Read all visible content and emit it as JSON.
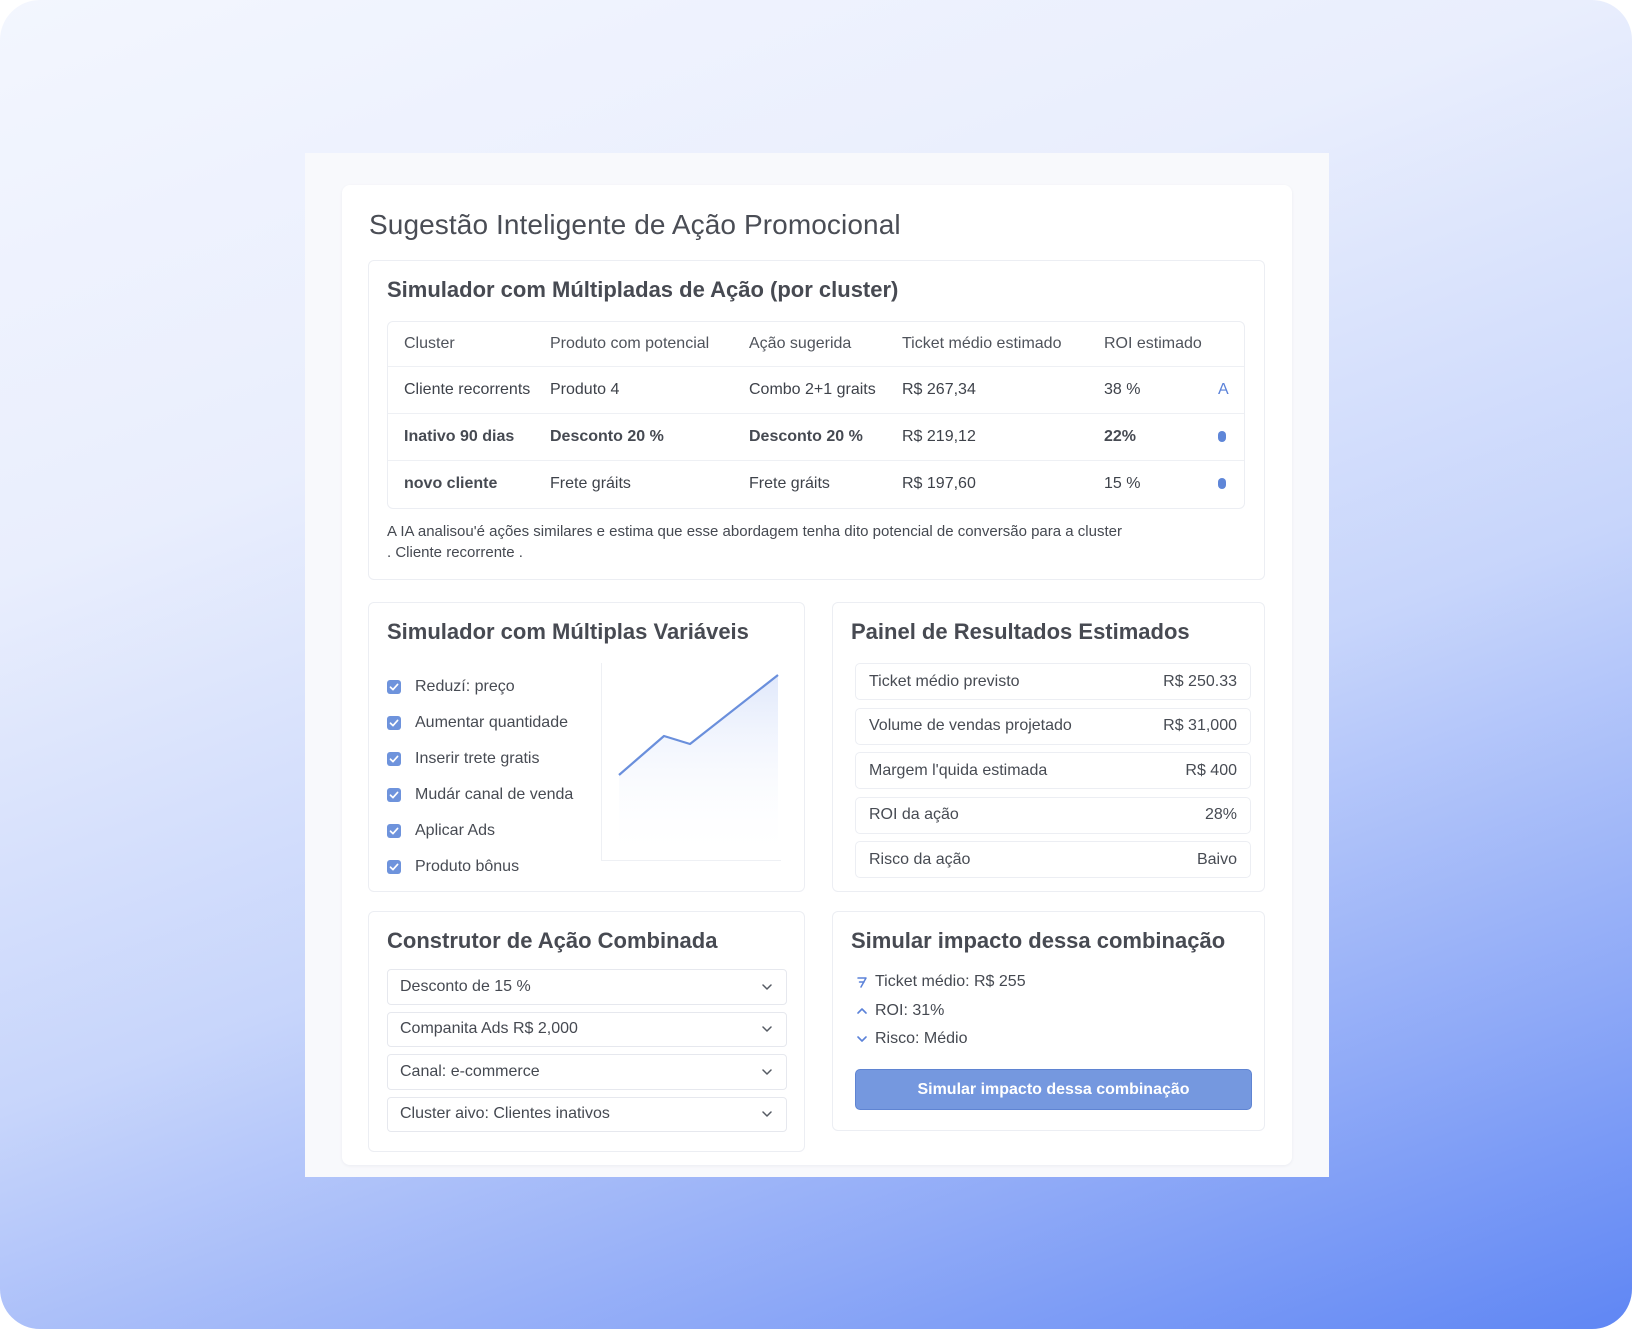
{
  "page_title": "Sugestão Inteligente de Ação Promocional",
  "cluster_sim": {
    "title": "Simulador com Múltipladas de Ação (por cluster)",
    "columns": [
      "Cluster",
      "Produto com potencial",
      "Ação sugerida",
      "Ticket médio estimado",
      "ROI estimado"
    ],
    "rows": [
      {
        "cluster": "Cliente recorrents",
        "produto": "Produto 4",
        "acao": "Combo 2+1 graits",
        "ticket": "R$ 267,34",
        "roi": "38 %",
        "tag": "A"
      },
      {
        "cluster": "Inativo 90 dias",
        "produto": "Desconto 20 %",
        "acao": "Desconto 20 %",
        "ticket": "R$ 219,12",
        "roi": "22%",
        "tag": ""
      },
      {
        "cluster": "novo cliente",
        "produto": "Frete gráits",
        "acao": "Frete gráits",
        "ticket": "R$ 197,60",
        "roi": "15 %",
        "tag": ""
      }
    ],
    "note_line1": "A IA analisou'é ações similares e estima que esse abordagem tenha dito potencial de conversão para a cluster",
    "note_line2": ". Cliente recorrente ."
  },
  "variables": {
    "title": "Simulador com Múltiplas Variáveis",
    "items": [
      "Reduzí: preço",
      "Aumentar quantidade",
      "Inserir trete gratis",
      "Mudár canal de venda",
      "Aplicar Ads",
      "Produto bônus"
    ],
    "accent": "#5b82d9"
  },
  "results": {
    "title": "Painel de Resultados Estimados",
    "rows": [
      {
        "label": "Ticket médio previsto",
        "value": "R$ 250.33"
      },
      {
        "label": "Volume de vendas projetado",
        "value": "R$ 31,000"
      },
      {
        "label": "Margem l'quida estimada",
        "value": "R$ 400"
      },
      {
        "label": "ROI da ação",
        "value": "28%"
      },
      {
        "label": "Risco da ação",
        "value": "Baivo"
      }
    ]
  },
  "builder": {
    "title": "Construtor de Ação Combinada",
    "selects": [
      "Desconto de 15 %",
      "Companita Ads R$ 2,000",
      "Canal: e-commerce",
      "Cluster aivo: Clientes inativos"
    ]
  },
  "impact": {
    "title": "Simular impacto dessa combinação",
    "items": [
      {
        "icon": "trend-icon",
        "text": "Ticket médio: R$ 255"
      },
      {
        "icon": "chevron-up-icon",
        "text": "ROI: 31%"
      },
      {
        "icon": "chevron-down-icon",
        "text": "Risco: Médio"
      }
    ],
    "button_label": "Simular impacto dessa combinação",
    "button_color": "#7598df"
  }
}
